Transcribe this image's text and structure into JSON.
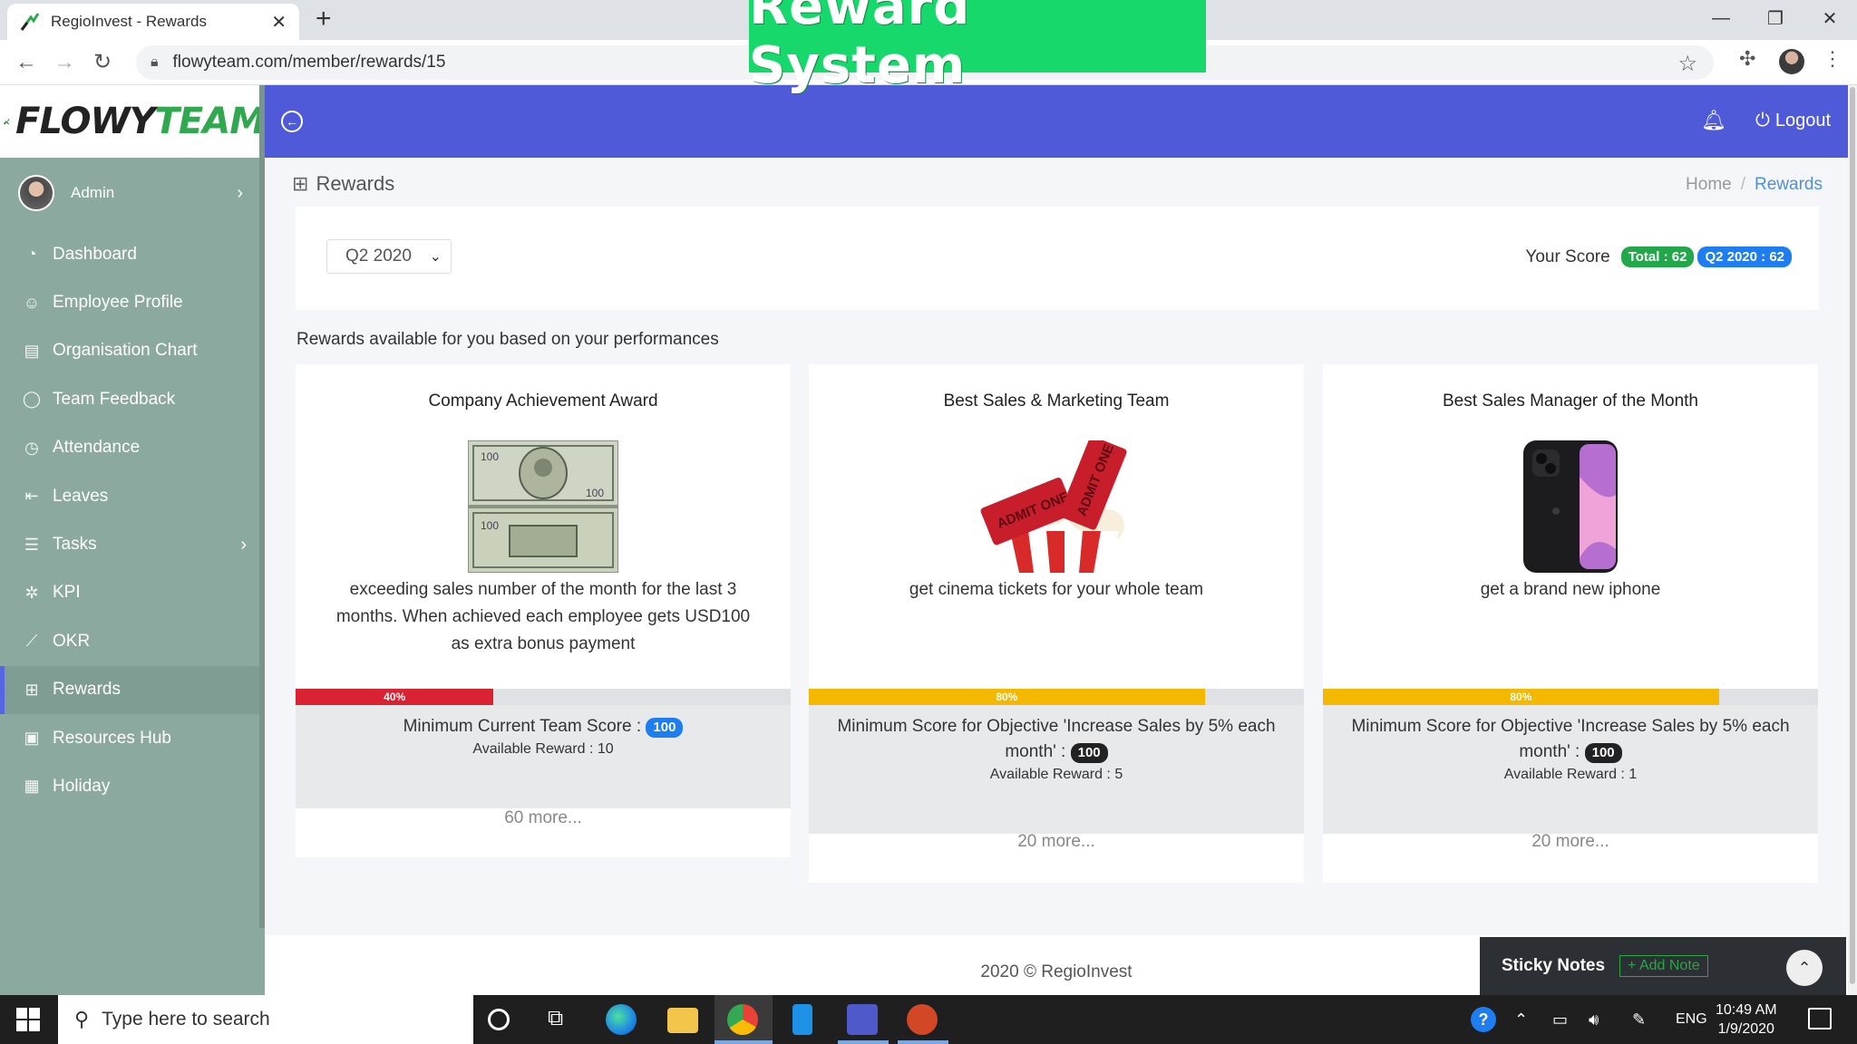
{
  "browser": {
    "tab_title": "RegioInvest - Rewards",
    "url": "flowyteam.com/member/rewards/15",
    "overlay_title": "Reward System"
  },
  "sidebar": {
    "brand_part1": "FLOWY",
    "brand_part2": "TEAM",
    "user_name": "Admin",
    "items": [
      {
        "label": "Dashboard",
        "icon": "dashboard-icon"
      },
      {
        "label": "Employee Profile",
        "icon": "user-icon"
      },
      {
        "label": "Organisation Chart",
        "icon": "org-chart-icon"
      },
      {
        "label": "Team Feedback",
        "icon": "chat-icon"
      },
      {
        "label": "Attendance",
        "icon": "clock-icon"
      },
      {
        "label": "Leaves",
        "icon": "sign-out-icon"
      },
      {
        "label": "Tasks",
        "icon": "tasks-icon"
      },
      {
        "label": "KPI",
        "icon": "kpi-icon"
      },
      {
        "label": "OKR",
        "icon": "okr-icon"
      },
      {
        "label": "Rewards",
        "icon": "gift-icon"
      },
      {
        "label": "Resources Hub",
        "icon": "resources-icon"
      },
      {
        "label": "Holiday",
        "icon": "calendar-icon"
      }
    ],
    "active": "Rewards"
  },
  "topbar": {
    "logout_label": "Logout"
  },
  "page": {
    "title": "Rewards",
    "breadcrumb_home": "Home",
    "breadcrumb_current": "Rewards",
    "quarter_selected": "Q2 2020",
    "score_label": "Your Score",
    "score_total": "Total : 62",
    "score_quarter": "Q2 2020 : 62",
    "section_title": "Rewards available for you based on your performances"
  },
  "rewards": [
    {
      "title": "Company Achievement Award",
      "image": "dollar-bills-image",
      "description": "exceeding sales number of the month for the last 3 months. When achieved each employee gets USD100 as extra bonus payment",
      "progress_label": "40%",
      "progress": 0.4,
      "progress_color": "#d92332",
      "min_text": "Minimum Current Team Score :",
      "min_value": "100",
      "available": "Available Reward : 10",
      "more": "60 more..."
    },
    {
      "title": "Best Sales & Marketing Team",
      "image": "cinema-tickets-image",
      "description": "get cinema tickets for your whole team",
      "progress_label": "80%",
      "progress": 0.8,
      "progress_color": "#f5b800",
      "min_text": "Minimum Score for Objective 'Increase Sales by 5% each month' :",
      "min_value": "100",
      "available": "Available Reward : 5",
      "more": "20 more..."
    },
    {
      "title": "Best Sales Manager of the Month",
      "image": "iphone-image",
      "description": "get a brand new iphone",
      "progress_label": "80%",
      "progress": 0.8,
      "progress_color": "#f5b800",
      "min_text": "Minimum Score for Objective 'Increase Sales by 5% each month' :",
      "min_value": "100",
      "available": "Available Reward : 1",
      "more": "20 more..."
    }
  ],
  "footer": {
    "copyright": "2020 © RegioInvest",
    "sticky_label": "Sticky Notes",
    "add_note": "+ Add Note"
  },
  "taskbar": {
    "search_placeholder": "Type here to search",
    "language": "ENG",
    "time": "10:49 AM",
    "date": "1/9/2020"
  }
}
